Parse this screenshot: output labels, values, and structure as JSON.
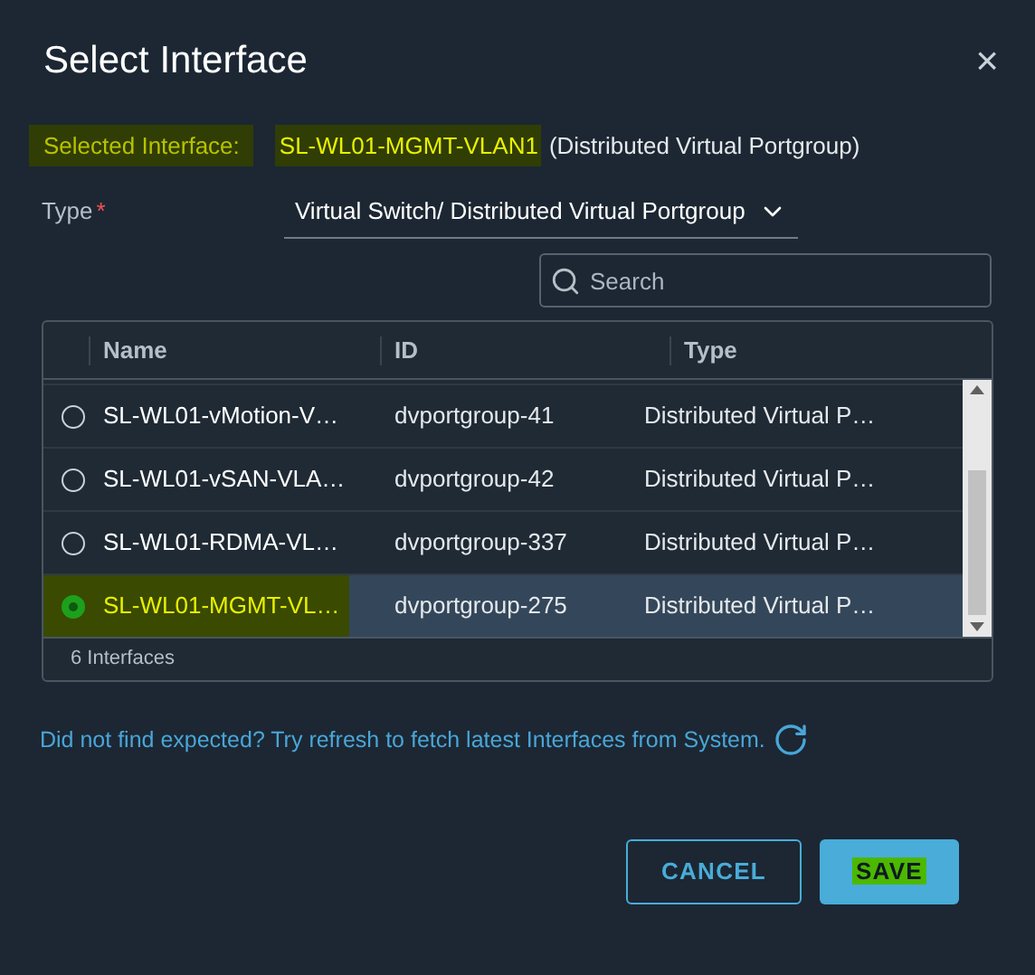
{
  "dialog": {
    "title": "Select Interface",
    "close": "×"
  },
  "selected_interface": {
    "label": "Selected Interface:",
    "label_highlighted": true,
    "name": "SL-WL01-MGMT-VLAN1",
    "name_highlighted": true,
    "suffix": "(Distributed Virtual Portgroup)"
  },
  "type_field": {
    "label": "Type",
    "required_mark": "*",
    "value": "Virtual Switch/ Distributed Virtual Portgroup"
  },
  "search": {
    "placeholder": "Search"
  },
  "table": {
    "columns": [
      "Name",
      "ID",
      "Type"
    ],
    "rows": [
      {
        "name": "SL-WL01-vMotion-V…",
        "id": "dvportgroup-41",
        "type": "Distributed Virtual P…",
        "selected": false,
        "highlighted": false
      },
      {
        "name": "SL-WL01-vSAN-VLA…",
        "id": "dvportgroup-42",
        "type": "Distributed Virtual P…",
        "selected": false,
        "highlighted": false
      },
      {
        "name": "SL-WL01-RDMA-VL…",
        "id": "dvportgroup-337",
        "type": "Distributed Virtual P…",
        "selected": false,
        "highlighted": false
      },
      {
        "name": "SL-WL01-MGMT-VL…",
        "id": "dvportgroup-275",
        "type": "Distributed Virtual P…",
        "selected": true,
        "highlighted": true
      }
    ],
    "footer": "6 Interfaces"
  },
  "hint": "Did not find expected? Try refresh to fetch latest Interfaces from System.",
  "buttons": [
    {
      "label": "CANCEL",
      "kind": "outline",
      "highlighted": false
    },
    {
      "label": "SAVE",
      "kind": "primary",
      "highlighted": true
    }
  ]
}
